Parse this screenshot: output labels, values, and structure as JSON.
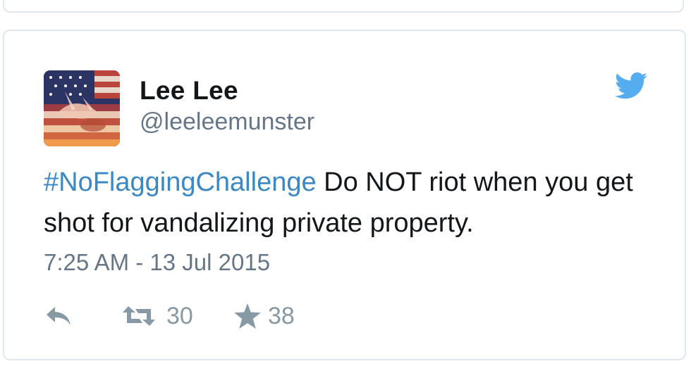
{
  "tweet": {
    "display_name": "Lee Lee",
    "handle": "@leeleemunster",
    "hashtag": "#NoFlaggingChallenge",
    "text": " Do NOT riot when you get shot for vandalizing private property.",
    "timestamp": "7:25 AM - 13 Jul 2015",
    "retweet_count": "30",
    "like_count": "38"
  },
  "icons": {
    "brand": "twitter-bird-icon",
    "reply": "reply-icon",
    "retweet": "retweet-icon",
    "like": "star-icon"
  },
  "colors": {
    "link": "#3b88c3",
    "brand": "#55acee",
    "muted": "#657786",
    "action": "#8899a6",
    "border": "#e1e8ed"
  }
}
